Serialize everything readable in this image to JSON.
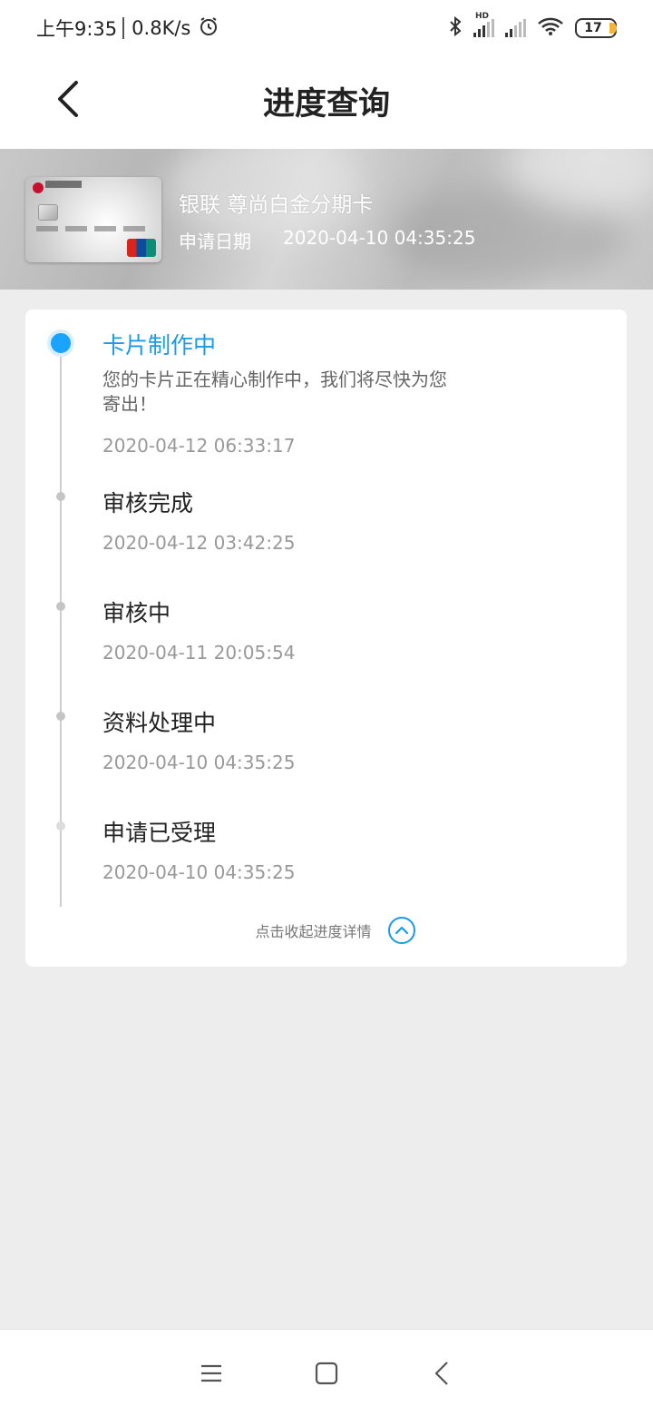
{
  "status_bar": {
    "time": "上午9:35",
    "speed": "0.8K/s",
    "hd_label": "HD",
    "battery": "17"
  },
  "header": {
    "title": "进度查询",
    "back_icon": "chevron-left-icon"
  },
  "card_info": {
    "name": "银联 尊尚白金分期卡",
    "apply_label": "申请日期",
    "apply_date": "2020-04-10 04:35:25"
  },
  "steps": [
    {
      "title": "卡片制作中",
      "description": "您的卡片正在精心制作中，我们将尽快为您寄出！",
      "time": "2020-04-12 06:33:17",
      "active": true
    },
    {
      "title": "审核完成",
      "time": "2020-04-12 03:42:25",
      "active": false
    },
    {
      "title": "审核中",
      "time": "2020-04-11 20:05:54",
      "active": false
    },
    {
      "title": "资料处理中",
      "time": "2020-04-10 04:35:25",
      "active": false
    },
    {
      "title": "申请已受理",
      "time": "2020-04-10 04:35:25",
      "active": false
    }
  ],
  "collapse": {
    "label": "点击收起进度详情",
    "icon": "chevron-up-circle-icon"
  },
  "colors": {
    "accent": "#1a9bea",
    "background": "#ededed"
  },
  "bottom_nav": {
    "menu_icon": "menu-icon",
    "home_icon": "home-square-icon",
    "back_icon": "back-triangle-icon"
  }
}
